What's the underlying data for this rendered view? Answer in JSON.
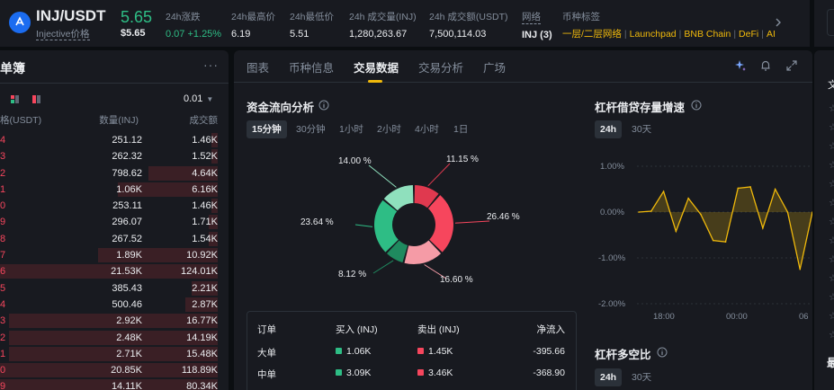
{
  "header": {
    "pair": "INJ/USDT",
    "subtitle": "Injective价格",
    "last_price": "5.65",
    "last_price_usd": "$5.65",
    "stats": [
      {
        "label": "24h涨跌",
        "value": "0.07 +1.25%"
      },
      {
        "label": "24h最高价",
        "value": "6.19"
      },
      {
        "label": "24h最低价",
        "value": "5.51"
      },
      {
        "label": "24h 成交量(INJ)",
        "value": "1,280,263.67"
      },
      {
        "label": "24h 成交额(USDT)",
        "value": "7,500,114.03"
      },
      {
        "label": "网络",
        "value": "INJ (3)"
      },
      {
        "label": "币种标签",
        "value": ""
      }
    ],
    "tags": [
      "一层/二层网络",
      "Launchpad",
      "BNB Chain",
      "DeFi",
      "AI"
    ],
    "colors": {
      "up": "#2ebd85",
      "down": "#f6465d",
      "accent": "#f0b90b"
    }
  },
  "orderbook": {
    "title": "单簿",
    "tick": "0.01",
    "headers": {
      "price": "格(USDT)",
      "qty": "数量(INJ)",
      "total": "成交额"
    },
    "rows": [
      {
        "price": "4",
        "qty": "251.12",
        "total": "1.46K",
        "depth": 0.03
      },
      {
        "price": "3",
        "qty": "262.32",
        "total": "1.52K",
        "depth": 0.03
      },
      {
        "price": "2",
        "qty": "798.62",
        "total": "4.64K",
        "depth": 0.32
      },
      {
        "price": "1",
        "qty": "1.06K",
        "total": "6.16K",
        "depth": 0.46
      },
      {
        "price": "0",
        "qty": "253.11",
        "total": "1.46K",
        "depth": 0.03
      },
      {
        "price": "9",
        "qty": "296.07",
        "total": "1.71K",
        "depth": 0.04
      },
      {
        "price": "8",
        "qty": "267.52",
        "total": "1.54K",
        "depth": 0.04
      },
      {
        "price": "7",
        "qty": "1.89K",
        "total": "10.92K",
        "depth": 0.55
      },
      {
        "price": "6",
        "qty": "21.53K",
        "total": "124.01K",
        "depth": 1.0
      },
      {
        "price": "5",
        "qty": "385.43",
        "total": "2.21K",
        "depth": 0.12
      },
      {
        "price": "4",
        "qty": "500.46",
        "total": "2.87K",
        "depth": 0.15
      },
      {
        "price": "3",
        "qty": "2.92K",
        "total": "16.77K",
        "depth": 0.96
      },
      {
        "price": "2",
        "qty": "2.48K",
        "total": "14.19K",
        "depth": 0.96
      },
      {
        "price": "1",
        "qty": "2.71K",
        "total": "15.48K",
        "depth": 0.96
      },
      {
        "price": "0",
        "qty": "20.85K",
        "total": "118.89K",
        "depth": 1.0
      },
      {
        "price": "9",
        "qty": "14.11K",
        "total": "80.34K",
        "depth": 1.0
      }
    ]
  },
  "tabs": [
    "图表",
    "币种信息",
    "交易数据",
    "交易分析",
    "广场"
  ],
  "active_tab": "交易数据",
  "fund_flow": {
    "title": "资金流向分析",
    "periods": [
      "15分钟",
      "30分钟",
      "1小时",
      "2小时",
      "4小时",
      "1日"
    ],
    "active_period": "15分钟",
    "slices": [
      {
        "label": "11.15 %",
        "value": 11.15,
        "color": "#e0394f"
      },
      {
        "label": "26.46 %",
        "value": 26.46,
        "color": "#f6465d"
      },
      {
        "label": "16.60 %",
        "value": 16.6,
        "color": "#f59ba6"
      },
      {
        "label": "8.12 %",
        "value": 8.12,
        "color": "#1f8a5f"
      },
      {
        "label": "23.64 %",
        "value": 23.64,
        "color": "#2ebd85"
      },
      {
        "label": "14.00 %",
        "value": 14.0,
        "color": "#8fe0bd"
      }
    ],
    "table": {
      "headers": [
        "订单",
        "买入 (INJ)",
        "卖出 (INJ)",
        "净流入"
      ],
      "rows": [
        {
          "type": "大单",
          "buy": "1.06K",
          "sell": "1.45K",
          "net": "-395.66"
        },
        {
          "type": "中单",
          "buy": "3.09K",
          "sell": "3.46K",
          "net": "-368.90"
        }
      ]
    }
  },
  "margin": {
    "title": "杠杆借贷存量增速",
    "periods": [
      "24h",
      "30天"
    ],
    "active_period": "24h",
    "chart_data": {
      "type": "line",
      "x_ticks": [
        "18:00",
        "00:00",
        "06"
      ],
      "y_ticks": [
        "1.00%",
        "0.00%",
        "-1.00%",
        "-2.00%"
      ],
      "ylim": [
        -2.0,
        1.0
      ],
      "values": [
        0.0,
        0.02,
        0.45,
        -0.42,
        0.3,
        -0.05,
        -0.62,
        -0.65,
        0.52,
        0.55,
        -0.35,
        0.5,
        0.0,
        -1.25,
        0.0
      ]
    }
  },
  "long_short": {
    "title": "杠杆多空比",
    "periods": [
      "24h",
      "30天"
    ],
    "active_period": "24h"
  },
  "right_strip": {
    "heading_char": "文",
    "bottom_char": "最"
  }
}
